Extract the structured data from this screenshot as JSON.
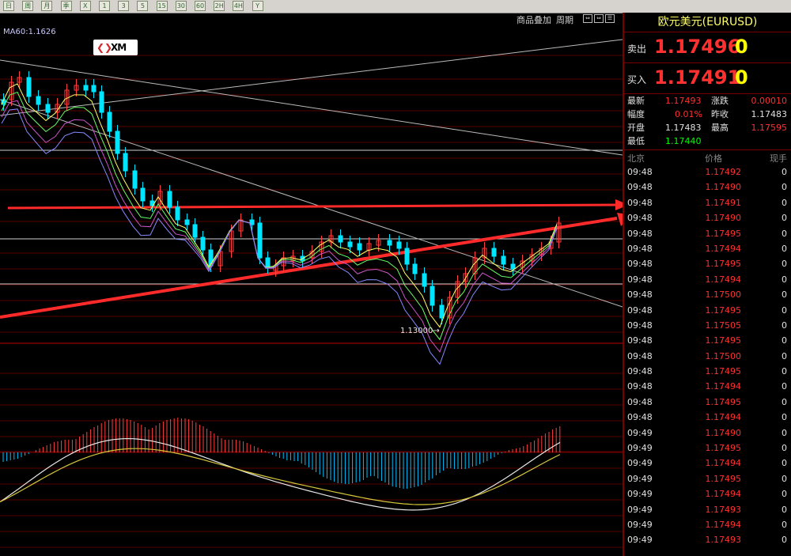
{
  "toolbar": {
    "buttons": [
      "日",
      "周",
      "月",
      "季",
      "X",
      "1",
      "3",
      "5",
      "15",
      "30",
      "60",
      "2H",
      "4H",
      "Y"
    ]
  },
  "chart_header": {
    "overlay_label": "商品叠加",
    "period_label": "周期"
  },
  "ma_label": "MA60:1.1626",
  "logo_text": "XM",
  "low_label": "1.13000",
  "colors": {
    "bull_candle": "#ff4040",
    "bear_candle": "#00e5ff",
    "trendline": "#ff2a2a",
    "grid": "#5a0000"
  },
  "side": {
    "title": "欧元美元(EURUSD)",
    "sell_label": "卖出",
    "sell_price": "1.17496",
    "sell_vol": "0",
    "buy_label": "买入",
    "buy_price": "1.17491",
    "buy_vol": "0",
    "stats": {
      "latest_label": "最新",
      "latest": "1.17493",
      "change_label": "涨跌",
      "change": "0.00010",
      "pct_label": "幅度",
      "pct": "0.01%",
      "prev_label": "昨收",
      "prev": "1.17483",
      "open_label": "开盘",
      "open": "1.17483",
      "high_label": "最高",
      "high": "1.17595",
      "low_label": "最低",
      "low": "1.17440"
    },
    "ticks_header": {
      "time": "北京",
      "price": "价格",
      "qty": "现手"
    },
    "ticks": [
      {
        "time": "09:48",
        "price": "1.17492",
        "qty": "0"
      },
      {
        "time": "09:48",
        "price": "1.17490",
        "qty": "0"
      },
      {
        "time": "09:48",
        "price": "1.17491",
        "qty": "0"
      },
      {
        "time": "09:48",
        "price": "1.17490",
        "qty": "0"
      },
      {
        "time": "09:48",
        "price": "1.17495",
        "qty": "0"
      },
      {
        "time": "09:48",
        "price": "1.17494",
        "qty": "0"
      },
      {
        "time": "09:48",
        "price": "1.17495",
        "qty": "0"
      },
      {
        "time": "09:48",
        "price": "1.17494",
        "qty": "0"
      },
      {
        "time": "09:48",
        "price": "1.17500",
        "qty": "0"
      },
      {
        "time": "09:48",
        "price": "1.17495",
        "qty": "0"
      },
      {
        "time": "09:48",
        "price": "1.17505",
        "qty": "0"
      },
      {
        "time": "09:48",
        "price": "1.17495",
        "qty": "0"
      },
      {
        "time": "09:48",
        "price": "1.17500",
        "qty": "0"
      },
      {
        "time": "09:48",
        "price": "1.17495",
        "qty": "0"
      },
      {
        "time": "09:48",
        "price": "1.17494",
        "qty": "0"
      },
      {
        "time": "09:48",
        "price": "1.17495",
        "qty": "0"
      },
      {
        "time": "09:48",
        "price": "1.17494",
        "qty": "0"
      },
      {
        "time": "09:49",
        "price": "1.17490",
        "qty": "0"
      },
      {
        "time": "09:49",
        "price": "1.17495",
        "qty": "0"
      },
      {
        "time": "09:49",
        "price": "1.17494",
        "qty": "0"
      },
      {
        "time": "09:49",
        "price": "1.17495",
        "qty": "0"
      },
      {
        "time": "09:49",
        "price": "1.17494",
        "qty": "0"
      },
      {
        "time": "09:49",
        "price": "1.17493",
        "qty": "0"
      },
      {
        "time": "09:49",
        "price": "1.17494",
        "qty": "0"
      },
      {
        "time": "09:49",
        "price": "1.17493",
        "qty": "0"
      }
    ]
  }
}
